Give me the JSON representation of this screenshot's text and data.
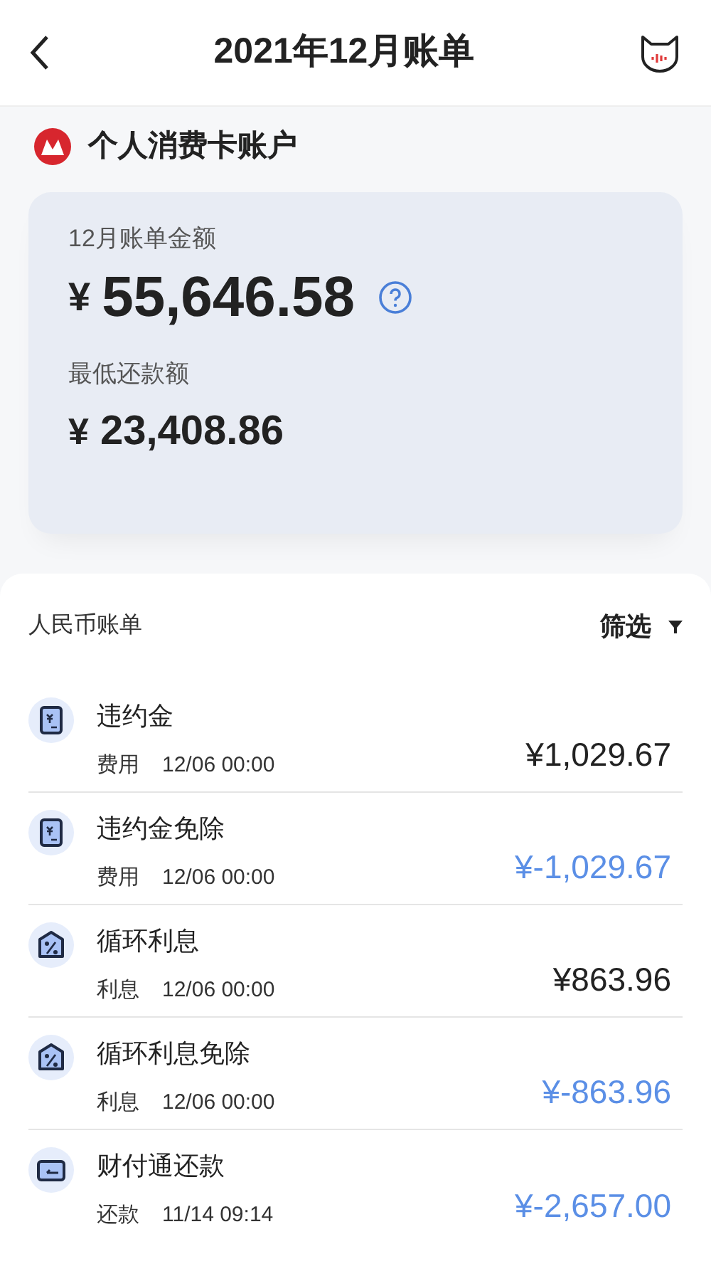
{
  "header": {
    "title": "2021年12月账单"
  },
  "account": {
    "name": "个人消费卡账户"
  },
  "summary": {
    "bill_label": "12月账单金额",
    "currency": "¥",
    "bill_amount": "55,646.58",
    "min_label": "最低还款额",
    "min_currency": "¥",
    "min_amount": "23,408.86"
  },
  "list": {
    "title": "人民币账单",
    "filter": "筛选"
  },
  "transactions": [
    {
      "kind": "fee",
      "title": "违约金",
      "category": "费用",
      "time": "12/06 00:00",
      "amount": "¥1,029.67",
      "credit": false
    },
    {
      "kind": "fee",
      "title": "违约金免除",
      "category": "费用",
      "time": "12/06 00:00",
      "amount": "¥-1,029.67",
      "credit": true
    },
    {
      "kind": "interest",
      "title": "循环利息",
      "category": "利息",
      "time": "12/06 00:00",
      "amount": "¥863.96",
      "credit": false
    },
    {
      "kind": "interest",
      "title": "循环利息免除",
      "category": "利息",
      "time": "12/06 00:00",
      "amount": "¥-863.96",
      "credit": true
    },
    {
      "kind": "repayment",
      "title": "财付通还款",
      "category": "还款",
      "time": "11/14 09:14",
      "amount": "¥-2,657.00",
      "credit": true
    }
  ]
}
